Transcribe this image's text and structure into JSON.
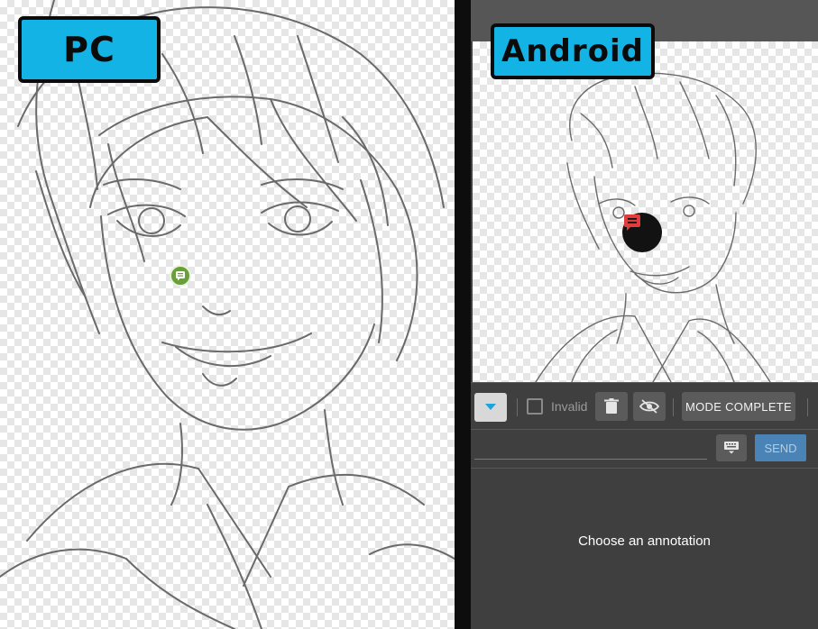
{
  "labels": {
    "pc": "PC",
    "android": "Android"
  },
  "android_toolbar": {
    "invalid_label": "Invalid",
    "mode_button_label": "MODE COMPLETE",
    "dropdown_arrow_icon": "triangle-down-icon",
    "delete_icon": "trash-icon",
    "visibility_icon": "eye-off-icon"
  },
  "android_input": {
    "value": "",
    "send_label": "SEND",
    "keyboard_icon": "keyboard-icon"
  },
  "annotation_panel": {
    "message": "Choose an annotation"
  },
  "colors": {
    "badge_fill": "#14b3e6",
    "pc_annotation_pin": "#6a9e3a",
    "android_annotation_pin": "#e23b3b",
    "send_button": "#4a83b5",
    "dropdown_arrow": "#1aa3dd",
    "panel_background": "#3f3f3f"
  }
}
